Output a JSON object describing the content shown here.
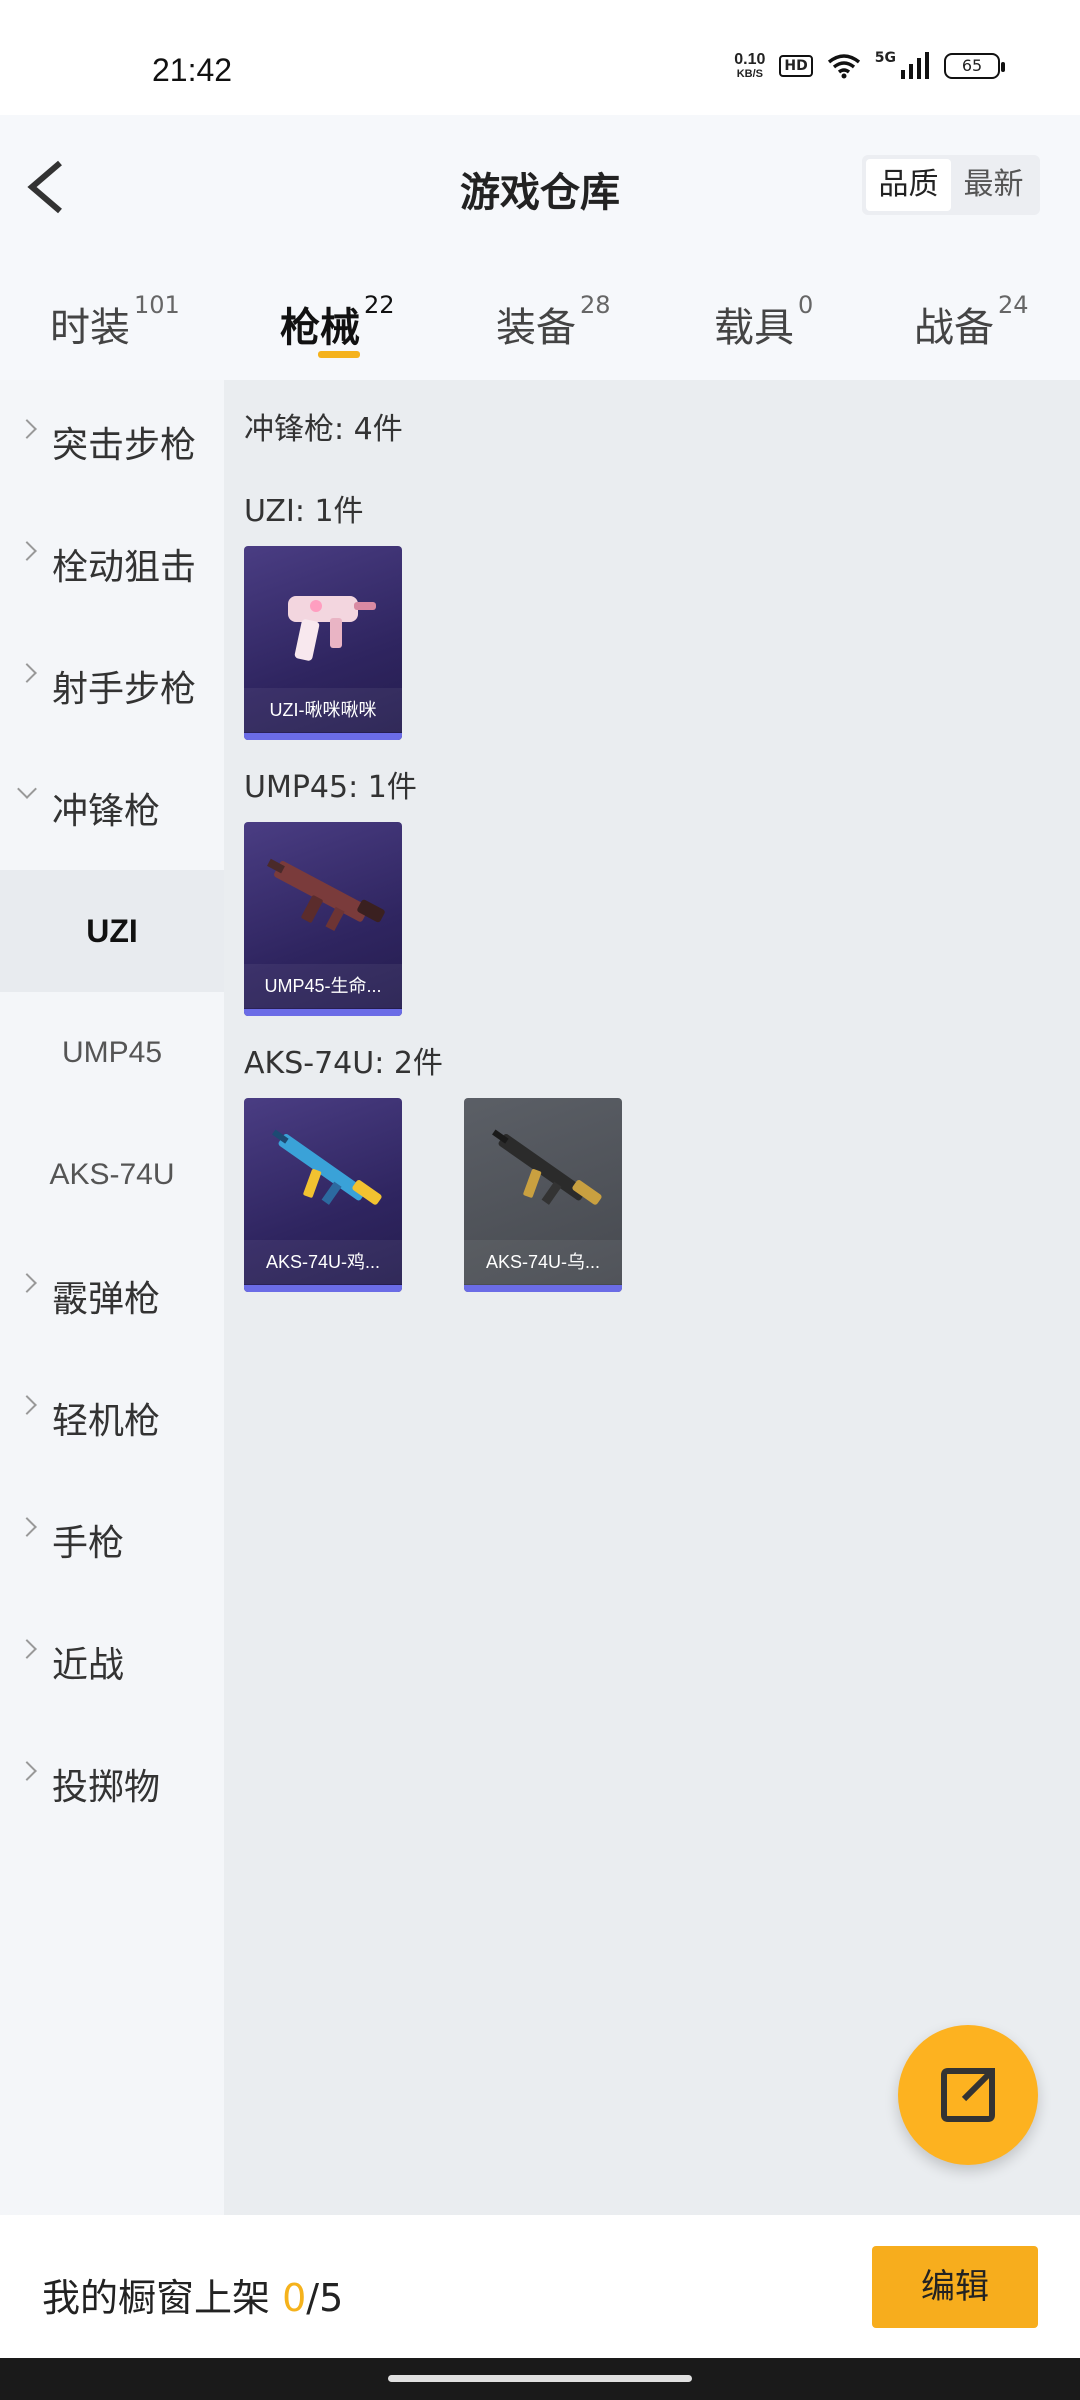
{
  "status": {
    "time": "21:42",
    "net_speed_value": "0.10",
    "net_speed_unit": "KB/S",
    "hd": "HD",
    "network": "5G",
    "battery": "65"
  },
  "header": {
    "title": "游戏仓库",
    "sort_options": [
      "品质",
      "最新"
    ],
    "active_sort": "品质"
  },
  "tabs": [
    {
      "label": "时装",
      "count": "101"
    },
    {
      "label": "枪械",
      "count": "22"
    },
    {
      "label": "装备",
      "count": "28"
    },
    {
      "label": "载具",
      "count": "0"
    },
    {
      "label": "战备",
      "count": "24"
    }
  ],
  "active_tab": "枪械",
  "sidebar": {
    "categories": [
      "突击步枪",
      "栓动狙击",
      "射手步枪",
      "冲锋枪",
      "霰弹枪",
      "轻机枪",
      "手枪",
      "近战",
      "投掷物"
    ],
    "expanded": "冲锋枪",
    "sub_items": [
      "UZI",
      "UMP45",
      "AKS-74U"
    ],
    "active_sub": "UZI"
  },
  "main": {
    "summary": "冲锋枪: 4件",
    "groups": [
      {
        "title": "UZI: 1件",
        "items": [
          {
            "name": "UZI-啾咪啾咪"
          }
        ]
      },
      {
        "title": "UMP45: 1件",
        "items": [
          {
            "name": "UMP45-生命..."
          }
        ]
      },
      {
        "title": "AKS-74U: 2件",
        "items": [
          {
            "name": "AKS-74U-鸡..."
          },
          {
            "name": "AKS-74U-乌..."
          }
        ]
      }
    ]
  },
  "bottom": {
    "showcase_label": "我的橱窗上架",
    "showcase_count": "0",
    "showcase_total": "/5",
    "edit_label": "编辑"
  },
  "colors": {
    "accent": "#f5b21c",
    "fab": "#fdb220",
    "rarity_bar": "#6b6ce6"
  }
}
